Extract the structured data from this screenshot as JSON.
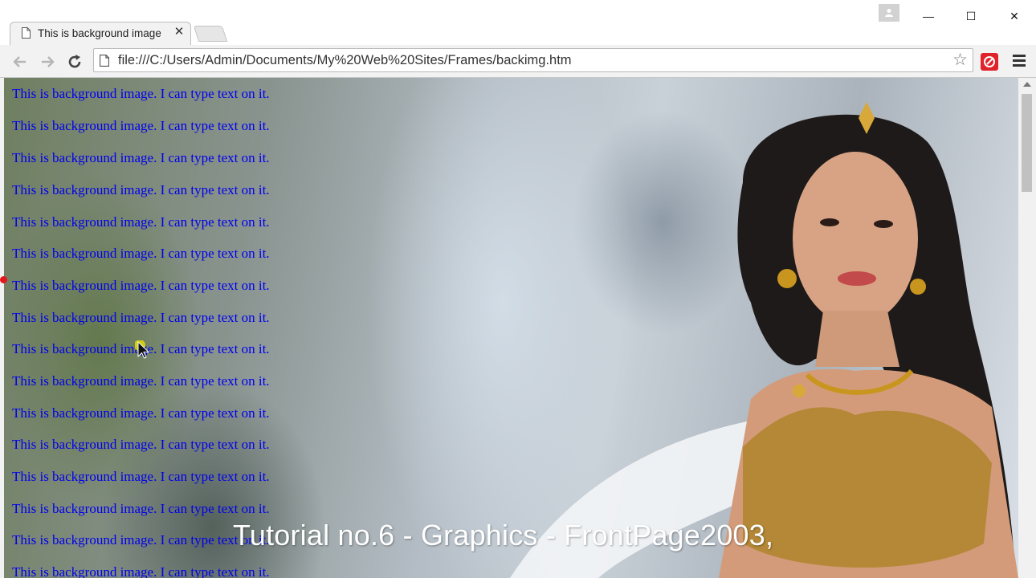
{
  "browser": {
    "tab": {
      "title": "This is background image",
      "close_label": "✕"
    },
    "window_buttons": {
      "minimize": "—",
      "maximize": "☐",
      "close": "✕"
    },
    "address_bar": {
      "url": "file:///C:/Users/Admin/Documents/My%20Web%20Sites/Frames/backimg.htm"
    }
  },
  "page": {
    "lines": [
      "This is background image. I can type text on it.",
      "This is background image. I can type text on it.",
      "This is background image. I can type text on it.",
      "This is background image. I can type text on it.",
      "This is background image. I can type text on it.",
      "This is background image. I can type text on it.",
      "This is background image. I can type text on it.",
      "This is background image. I can type text on it.",
      "This is background image. I can type text on it.",
      "This is background image. I can type text on it.",
      "This is background image. I can type text on it.",
      "This is background image. I can type text on it.",
      "This is background image. I can type text on it.",
      "This is background image. I can type text on it.",
      "This is background image. I can type text on it.",
      "This is background image. I can type text on it."
    ],
    "text_color": "#0000ee"
  },
  "overlay": {
    "caption": "Tutorial no.6 - Graphics - FrontPage2003,"
  },
  "icons": [
    "page-icon",
    "close-icon",
    "back-icon",
    "forward-icon",
    "reload-icon",
    "file-icon",
    "star-icon",
    "extension-icon",
    "menu-icon",
    "profile-icon"
  ]
}
